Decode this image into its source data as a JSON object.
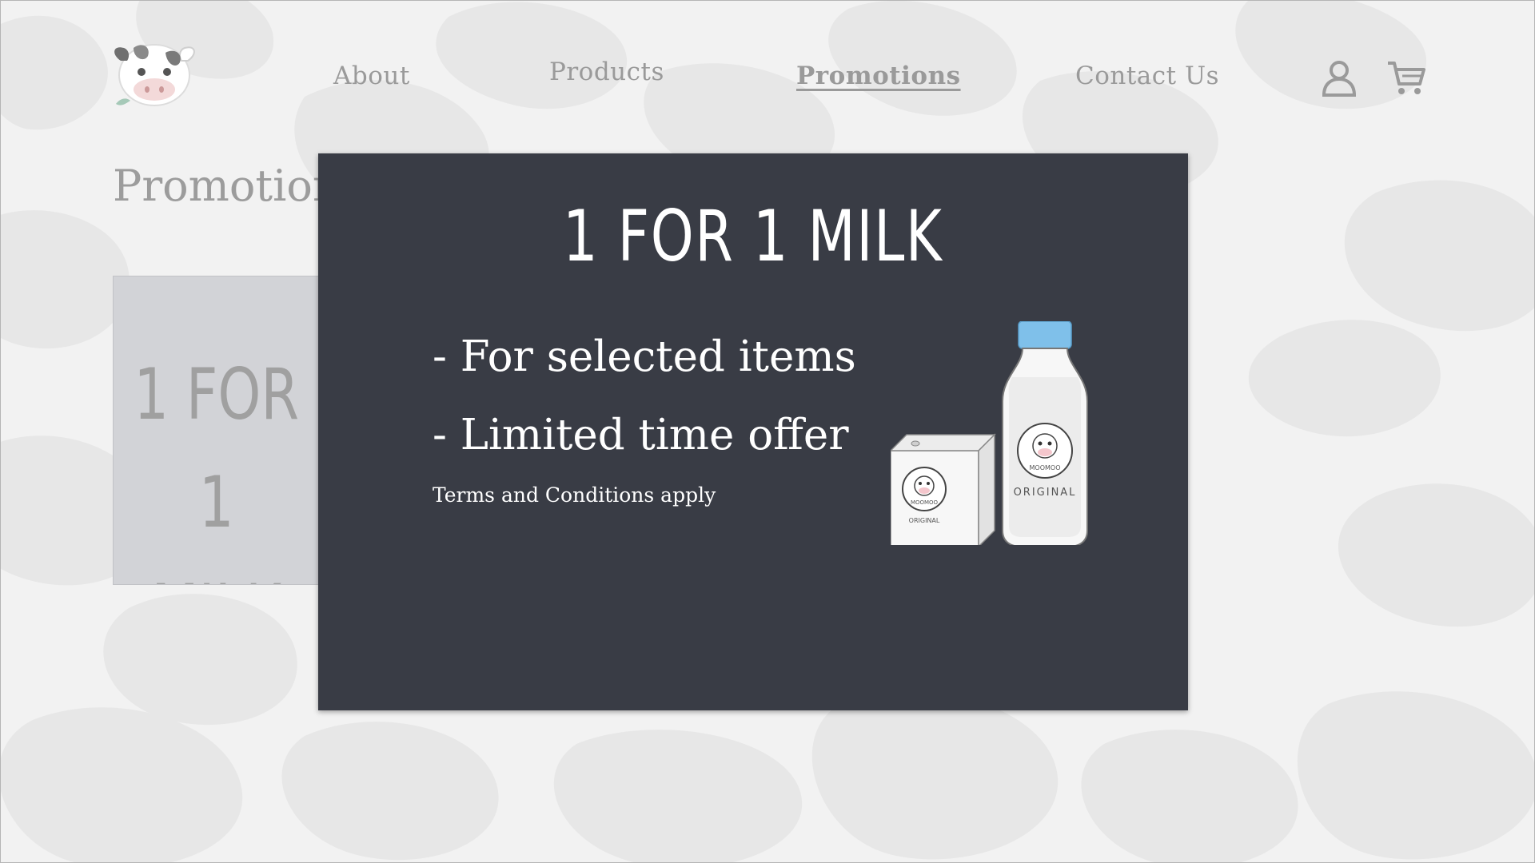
{
  "nav": {
    "items": [
      {
        "label": "About"
      },
      {
        "label": "Products"
      },
      {
        "label": "Promotions"
      },
      {
        "label": "Contact Us"
      }
    ],
    "active": "Promotions",
    "icons": [
      "cow-logo-icon",
      "user-icon",
      "cart-icon"
    ]
  },
  "page": {
    "title": "Promotions",
    "card_title_line1": "1 FOR 1",
    "card_title_line2": "MILK"
  },
  "modal": {
    "title": "1 FOR 1 MILK",
    "bullet1": "- For selected items",
    "bullet2": "- Limited time offer",
    "terms": "Terms and Conditions apply",
    "carton_brand": "MOOMOO",
    "carton_label": "ORIGINAL",
    "bottle_brand": "MOOMOO",
    "bottle_label": "ORIGINAL"
  },
  "colors": {
    "background": "#f2f2f2",
    "cow_spots": "#e6e6e6",
    "modal_bg": "#393c45",
    "nav_text": "#9a9a9a",
    "bottle_cap": "#7fc0ea",
    "card_bg": "#d2d3d7"
  }
}
